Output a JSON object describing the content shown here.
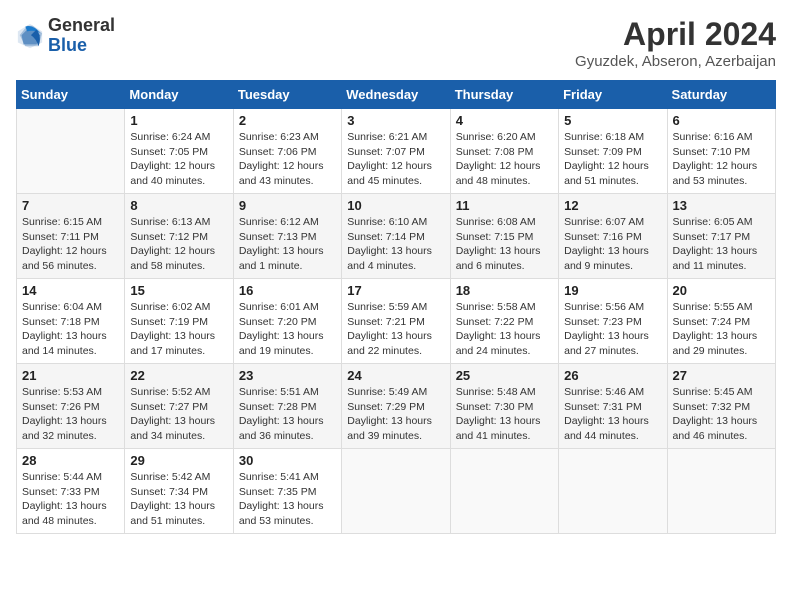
{
  "header": {
    "logo_general": "General",
    "logo_blue": "Blue",
    "month_title": "April 2024",
    "location": "Gyuzdek, Abseron, Azerbaijan"
  },
  "weekdays": [
    "Sunday",
    "Monday",
    "Tuesday",
    "Wednesday",
    "Thursday",
    "Friday",
    "Saturday"
  ],
  "weeks": [
    [
      {
        "day": "",
        "info": ""
      },
      {
        "day": "1",
        "info": "Sunrise: 6:24 AM\nSunset: 7:05 PM\nDaylight: 12 hours\nand 40 minutes."
      },
      {
        "day": "2",
        "info": "Sunrise: 6:23 AM\nSunset: 7:06 PM\nDaylight: 12 hours\nand 43 minutes."
      },
      {
        "day": "3",
        "info": "Sunrise: 6:21 AM\nSunset: 7:07 PM\nDaylight: 12 hours\nand 45 minutes."
      },
      {
        "day": "4",
        "info": "Sunrise: 6:20 AM\nSunset: 7:08 PM\nDaylight: 12 hours\nand 48 minutes."
      },
      {
        "day": "5",
        "info": "Sunrise: 6:18 AM\nSunset: 7:09 PM\nDaylight: 12 hours\nand 51 minutes."
      },
      {
        "day": "6",
        "info": "Sunrise: 6:16 AM\nSunset: 7:10 PM\nDaylight: 12 hours\nand 53 minutes."
      }
    ],
    [
      {
        "day": "7",
        "info": "Sunrise: 6:15 AM\nSunset: 7:11 PM\nDaylight: 12 hours\nand 56 minutes."
      },
      {
        "day": "8",
        "info": "Sunrise: 6:13 AM\nSunset: 7:12 PM\nDaylight: 12 hours\nand 58 minutes."
      },
      {
        "day": "9",
        "info": "Sunrise: 6:12 AM\nSunset: 7:13 PM\nDaylight: 13 hours\nand 1 minute."
      },
      {
        "day": "10",
        "info": "Sunrise: 6:10 AM\nSunset: 7:14 PM\nDaylight: 13 hours\nand 4 minutes."
      },
      {
        "day": "11",
        "info": "Sunrise: 6:08 AM\nSunset: 7:15 PM\nDaylight: 13 hours\nand 6 minutes."
      },
      {
        "day": "12",
        "info": "Sunrise: 6:07 AM\nSunset: 7:16 PM\nDaylight: 13 hours\nand 9 minutes."
      },
      {
        "day": "13",
        "info": "Sunrise: 6:05 AM\nSunset: 7:17 PM\nDaylight: 13 hours\nand 11 minutes."
      }
    ],
    [
      {
        "day": "14",
        "info": "Sunrise: 6:04 AM\nSunset: 7:18 PM\nDaylight: 13 hours\nand 14 minutes."
      },
      {
        "day": "15",
        "info": "Sunrise: 6:02 AM\nSunset: 7:19 PM\nDaylight: 13 hours\nand 17 minutes."
      },
      {
        "day": "16",
        "info": "Sunrise: 6:01 AM\nSunset: 7:20 PM\nDaylight: 13 hours\nand 19 minutes."
      },
      {
        "day": "17",
        "info": "Sunrise: 5:59 AM\nSunset: 7:21 PM\nDaylight: 13 hours\nand 22 minutes."
      },
      {
        "day": "18",
        "info": "Sunrise: 5:58 AM\nSunset: 7:22 PM\nDaylight: 13 hours\nand 24 minutes."
      },
      {
        "day": "19",
        "info": "Sunrise: 5:56 AM\nSunset: 7:23 PM\nDaylight: 13 hours\nand 27 minutes."
      },
      {
        "day": "20",
        "info": "Sunrise: 5:55 AM\nSunset: 7:24 PM\nDaylight: 13 hours\nand 29 minutes."
      }
    ],
    [
      {
        "day": "21",
        "info": "Sunrise: 5:53 AM\nSunset: 7:26 PM\nDaylight: 13 hours\nand 32 minutes."
      },
      {
        "day": "22",
        "info": "Sunrise: 5:52 AM\nSunset: 7:27 PM\nDaylight: 13 hours\nand 34 minutes."
      },
      {
        "day": "23",
        "info": "Sunrise: 5:51 AM\nSunset: 7:28 PM\nDaylight: 13 hours\nand 36 minutes."
      },
      {
        "day": "24",
        "info": "Sunrise: 5:49 AM\nSunset: 7:29 PM\nDaylight: 13 hours\nand 39 minutes."
      },
      {
        "day": "25",
        "info": "Sunrise: 5:48 AM\nSunset: 7:30 PM\nDaylight: 13 hours\nand 41 minutes."
      },
      {
        "day": "26",
        "info": "Sunrise: 5:46 AM\nSunset: 7:31 PM\nDaylight: 13 hours\nand 44 minutes."
      },
      {
        "day": "27",
        "info": "Sunrise: 5:45 AM\nSunset: 7:32 PM\nDaylight: 13 hours\nand 46 minutes."
      }
    ],
    [
      {
        "day": "28",
        "info": "Sunrise: 5:44 AM\nSunset: 7:33 PM\nDaylight: 13 hours\nand 48 minutes."
      },
      {
        "day": "29",
        "info": "Sunrise: 5:42 AM\nSunset: 7:34 PM\nDaylight: 13 hours\nand 51 minutes."
      },
      {
        "day": "30",
        "info": "Sunrise: 5:41 AM\nSunset: 7:35 PM\nDaylight: 13 hours\nand 53 minutes."
      },
      {
        "day": "",
        "info": ""
      },
      {
        "day": "",
        "info": ""
      },
      {
        "day": "",
        "info": ""
      },
      {
        "day": "",
        "info": ""
      }
    ]
  ]
}
